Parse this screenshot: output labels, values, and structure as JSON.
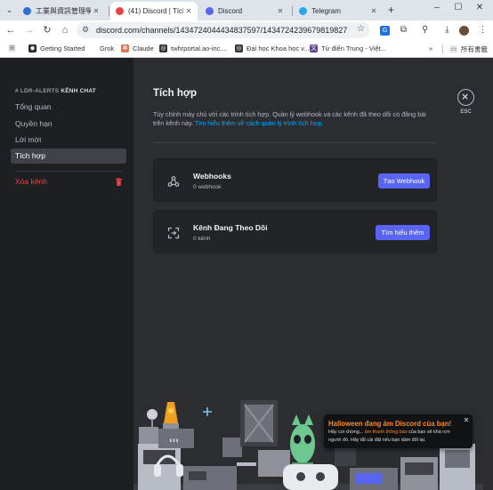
{
  "browser": {
    "tabs": [
      {
        "title": "工業與資訊管理學系（",
        "fav_color": "#2c6fd1",
        "active": false
      },
      {
        "title": "(41) Discord | Tích hợ",
        "fav_color": "#ed4245",
        "active": true
      },
      {
        "title": "Discord",
        "fav_color": "#5865f2",
        "active": false
      },
      {
        "title": "Telegram",
        "fav_color": "#29a9eb",
        "active": false
      }
    ],
    "address": {
      "url": "discord.com/channels/1434724044434837597/1434724239679819827"
    },
    "bookmarks": [
      {
        "label": "Getting Started",
        "icon": "G"
      },
      {
        "label": "Grok",
        "icon": "G"
      },
      {
        "label": "Claude",
        "icon": "✻"
      },
      {
        "label": "twhrportal.ao-inc....",
        "icon": "◎"
      },
      {
        "label": "Đại học Khoa học v...",
        "icon": "◎"
      },
      {
        "label": "Từ điển Trung - Việt...",
        "icon": "文"
      }
    ],
    "all_bookmarks_label": "所有書籤"
  },
  "sidebar": {
    "header_prefix": "# LDR-ALERTS",
    "header_suffix": "KÊNH CHAT",
    "items": [
      {
        "label": "Tổng quan",
        "selected": false
      },
      {
        "label": "Quyền hạn",
        "selected": false
      },
      {
        "label": "Lời mời",
        "selected": false
      },
      {
        "label": "Tích hợp",
        "selected": true
      }
    ],
    "delete_label": "Xóa kênh"
  },
  "main": {
    "title": "Tích hợp",
    "description": "Tùy chỉnh máy chủ với các trình tích hợp. Quản lý webhook và các kênh đã theo dõi có đăng bài trên kênh này.",
    "learn_more_link": "Tìm hiểu thêm về cách quản lý trình tích hợp.",
    "close_label": "ESC",
    "cards": [
      {
        "title": "Webhooks",
        "subtitle": "0 webhook",
        "button": "Tạo Webhook",
        "icon": "webhook-icon"
      },
      {
        "title": "Kênh Đang Theo Dõi",
        "subtitle": "0 kênh",
        "button": "Tìm hiểu thêm",
        "icon": "follow-channel-icon"
      }
    ]
  },
  "toast": {
    "title": "Halloween đang ám Discord của bạn!",
    "body_before": "Hãy coi chừng... ",
    "body_highlight": "âm thanh thông báo",
    "body_after": " của bạn sẽ khá rợn người đó. Hãy tắt cài đặt nếu bạn dám đổi lại."
  },
  "colors": {
    "accent": "#5865f2",
    "danger": "#f23f43",
    "link": "#00a8fc",
    "halloween": "#ff8a1f"
  }
}
